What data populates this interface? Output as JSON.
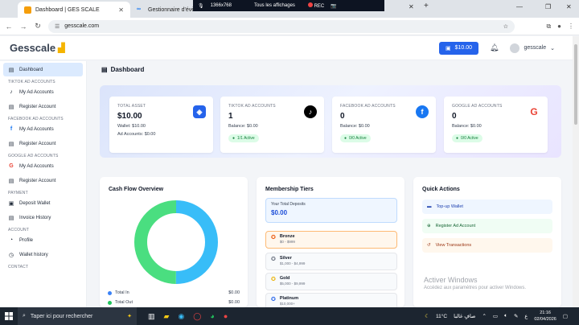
{
  "browser": {
    "tabs": [
      {
        "title": "Dashboard | GES SCALE",
        "active": true
      },
      {
        "title": "Gestionnaire d'évènement",
        "active": false
      }
    ],
    "new_tab": "+",
    "url": "gesscale.com"
  },
  "recording_bar": {
    "resolution": "1366x768",
    "display": "Tous les affichages",
    "rec": "REC"
  },
  "header": {
    "logo": "Gesscale",
    "wallet_balance": "$10.00",
    "username": "gesscale"
  },
  "sidebar": {
    "dashboard": "Dashboard",
    "sections": [
      {
        "title": "TIKTOK AD ACCOUNTS",
        "items": [
          {
            "label": "My Ad Accounts",
            "icon": "tiktok-icon"
          },
          {
            "label": "Register Account",
            "icon": "document-icon"
          }
        ]
      },
      {
        "title": "FACEBOOK AD ACCOUNTS",
        "items": [
          {
            "label": "My Ad Accounts",
            "icon": "facebook-icon"
          },
          {
            "label": "Register Account",
            "icon": "document-icon"
          }
        ]
      },
      {
        "title": "GOOGLE AD ACCOUNTS",
        "items": [
          {
            "label": "My Ad Accounts",
            "icon": "google-icon"
          },
          {
            "label": "Register Account",
            "icon": "document-icon"
          }
        ]
      },
      {
        "title": "PAYMENT",
        "items": [
          {
            "label": "Deposit Wallet",
            "icon": "wallet-icon"
          },
          {
            "label": "Invoice History",
            "icon": "document-icon"
          }
        ]
      },
      {
        "title": "ACCOUNT",
        "items": [
          {
            "label": "Profile",
            "icon": "user-icon"
          },
          {
            "label": "Wallet history",
            "icon": "history-icon"
          }
        ]
      },
      {
        "title": "CONTACT",
        "items": []
      }
    ]
  },
  "page": {
    "title": "Dashboard"
  },
  "stats": [
    {
      "title": "TOTAL ASSET",
      "value": "$10.00",
      "line1": "Wallet:  $10.00",
      "line2": "Ad Accounts:  $0.00",
      "badge": "",
      "icon": "wallet-icon",
      "icon_color": "#2563eb"
    },
    {
      "title": "TIKTOK AD ACCOUNTS",
      "value": "1",
      "line1": "Balance: $0.00",
      "line2": "",
      "badge": "1/1  Active",
      "icon": "tiktok-icon",
      "icon_color": "#000000"
    },
    {
      "title": "FACEBOOK AD ACCOUNTS",
      "value": "0",
      "line1": "Balance: $0.00",
      "line2": "",
      "badge": "0/0  Active",
      "icon": "facebook-icon",
      "icon_color": "#1877f2"
    },
    {
      "title": "GOOGLE AD ACCOUNTS",
      "value": "0",
      "line1": "Balance: $0.00",
      "line2": "",
      "badge": "0/0  Active",
      "icon": "google-icon",
      "icon_color": "#ea4335"
    }
  ],
  "cashflow": {
    "title": "Cash Flow Overview",
    "legend": [
      {
        "label": "Total In",
        "value": "$0.00",
        "color": "#3b82f6"
      },
      {
        "label": "Total Out",
        "value": "$0.00",
        "color": "#22c55e"
      }
    ]
  },
  "chart_data": {
    "type": "pie",
    "categories": [
      "Total In",
      "Total Out"
    ],
    "values": [
      50,
      50
    ],
    "colors": [
      "#38bdf8",
      "#4ade80"
    ]
  },
  "membership": {
    "title": "Membership Tiers",
    "total_label": "Your Total Deposits",
    "total_value": "$0.00",
    "tiers": [
      {
        "name": "Bronze",
        "range": "$0 - $999",
        "current": true
      },
      {
        "name": "Silver",
        "range": "$1,000 - $4,999",
        "current": false
      },
      {
        "name": "Gold",
        "range": "$5,000 - $9,999",
        "current": false
      },
      {
        "name": "Platinum",
        "range": "$10,000+",
        "current": false
      }
    ]
  },
  "quick_actions": {
    "title": "Quick Actions",
    "items": [
      {
        "label": "Top-up Wallet",
        "bg": "#eff6ff",
        "color": "#1e40af"
      },
      {
        "label": "Register Ad Account",
        "bg": "#f0fdf4",
        "color": "#166534"
      },
      {
        "label": "View Transactions",
        "bg": "#fff7ed",
        "color": "#9a3412"
      }
    ]
  },
  "watermark": {
    "line1": "Activer Windows",
    "line2": "Accédez aux paramètres pour activer Windows."
  },
  "taskbar": {
    "search_placeholder": "Taper ici pour rechercher",
    "weather": "11°C",
    "weather_text": "صافٍ غالبا",
    "lang": "ع",
    "time": "21:16",
    "date": "02/04/2026"
  }
}
